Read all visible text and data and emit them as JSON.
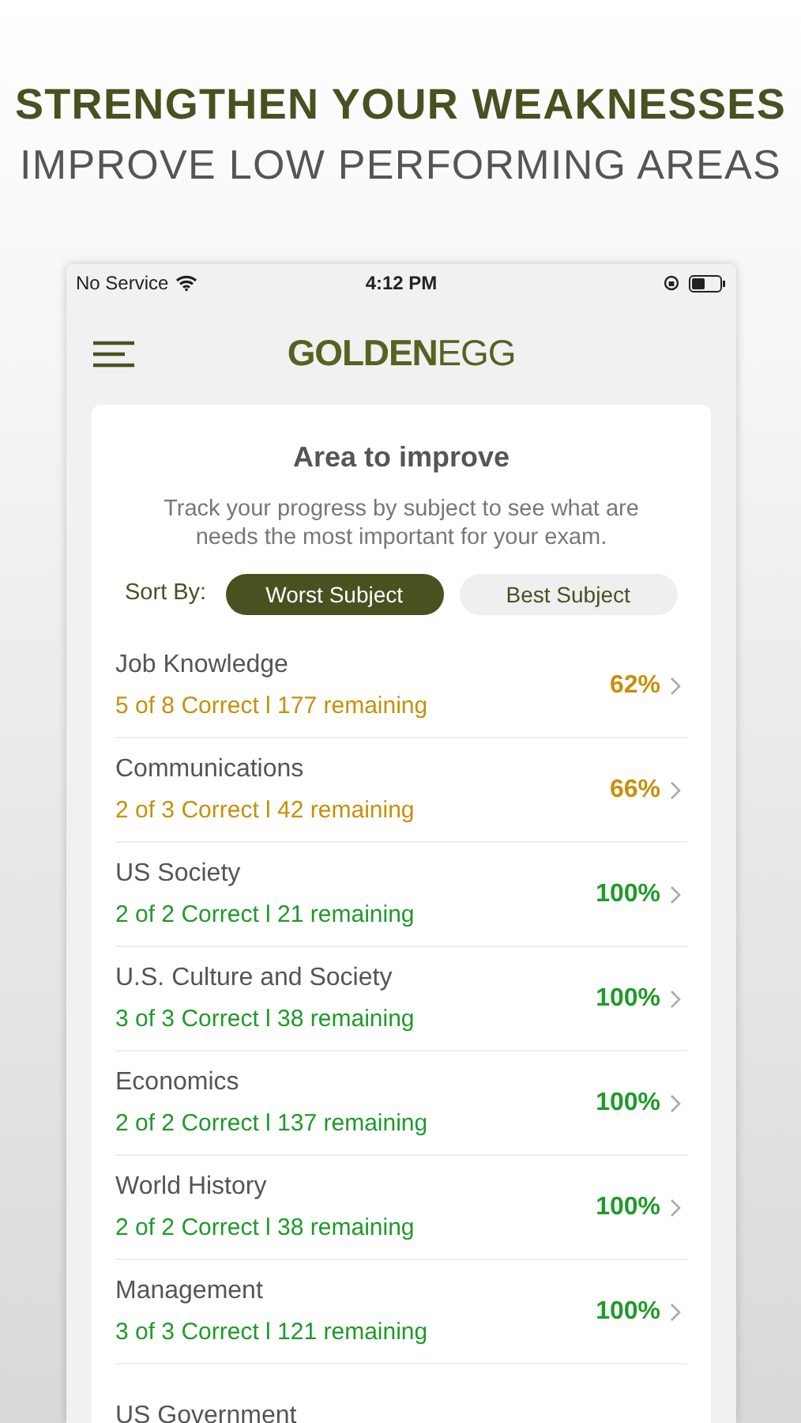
{
  "headline": "STRENGTHEN YOUR WEAKNESSES",
  "subheadline": "IMPROVE LOW PERFORMING AREAS",
  "status_bar": {
    "carrier": "No Service",
    "time": "4:12 PM"
  },
  "logo": "**GOLDEN**EGG",
  "card": {
    "title": "Area to improve",
    "description": "Track your progress by subject to see what are needs the most important for your exam.",
    "sort_label": "Sort By:",
    "sort_options": [
      {
        "label": "Worst Subject",
        "selected": true
      },
      {
        "label": "Best Subject",
        "selected": false
      }
    ]
  },
  "subjects": [
    {
      "name": "Job Knowledge",
      "detail": "5 of 8  Correct l 177 remaining",
      "percent": "62%",
      "color": "#c8900a"
    },
    {
      "name": "Communications",
      "detail": "2 of 3  Correct l 42 remaining",
      "percent": "66%",
      "color": "#c8900a"
    },
    {
      "name": "US Society",
      "detail": "2 of 2  Correct l 21 remaining",
      "percent": "100%",
      "color": "#1f9a2a"
    },
    {
      "name": "U.S. Culture and Society",
      "detail": "3 of 3  Correct l 38 remaining",
      "percent": "100%",
      "color": "#1f9a2a"
    },
    {
      "name": "Economics",
      "detail": "2 of 2  Correct l 137 remaining",
      "percent": "100%",
      "color": "#1f9a2a"
    },
    {
      "name": "World History",
      "detail": "2 of 2  Correct l 38 remaining",
      "percent": "100%",
      "color": "#1f9a2a"
    },
    {
      "name": "Management",
      "detail": "3 of 3  Correct l 121 remaining",
      "percent": "100%",
      "color": "#1f9a2a"
    },
    {
      "name": "US Government"
    }
  ]
}
